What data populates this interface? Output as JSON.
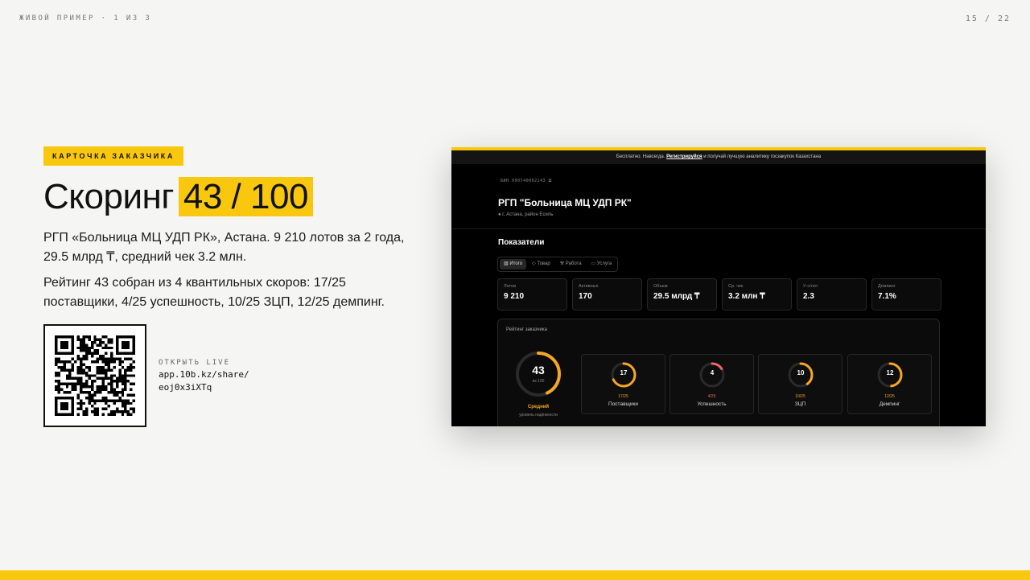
{
  "slide": {
    "top_left": "ЖИВОЙ ПРИМЕР · 1 ИЗ 3",
    "counter": "15 / 22",
    "eyebrow": "КАРТОЧКА ЗАКАЗЧИКА",
    "title_main": "Скоринг",
    "title_score": "43 / 100",
    "para1": "РГП «Больница МЦ УДП РК», Астана. 9 210 лотов за 2 года, 29.5 млрд ₸, средний чек 3.2 млн.",
    "para2": "Рейтинг 43 собран из 4 квантильных скоров: 17/25 поставщики, 4/25 успешность, 10/25 ЗЦП, 12/25 демпинг.",
    "live_label": "ОТКРЫТЬ LIVE",
    "live_url_1": "app.10b.kz/share/",
    "live_url_2": "eoj0x3iXTq"
  },
  "app": {
    "banner_pre": "Бесплатно. Навсегда.",
    "banner_link": "Регистрируйся",
    "banner_post": "и получай лучшую аналитику госзакупок Казахстана",
    "bin": "БИН 990740002243",
    "org_name": "РГП \"Больница МЦ УДП РК\"",
    "location": "г. Астана, район Есиль",
    "indicators_title": "Показатели",
    "tabs": [
      {
        "icon": "chart",
        "label": "Итого"
      },
      {
        "icon": "box",
        "label": "Товар"
      },
      {
        "icon": "wrench",
        "label": "Работа"
      },
      {
        "icon": "case",
        "label": "Услуга"
      }
    ],
    "kpis": [
      {
        "label": "Лотов",
        "value": "9 210"
      },
      {
        "label": "Активных",
        "value": "170"
      },
      {
        "label": "Объем",
        "value": "29.5 млрд ₸"
      },
      {
        "label": "Ср. чек",
        "value": "3.2 млн ₸"
      },
      {
        "label": "У-с/лот",
        "value": "2.3"
      },
      {
        "label": "Демпинг",
        "value": "7.1%"
      }
    ],
    "rating": {
      "title": "Рейтинг заказчика",
      "score": "43",
      "score_value": 43,
      "score_max": 100,
      "of_label": "из 100",
      "level": "Средний",
      "level_sub": "уровень надёжности",
      "accent": "#f5a623",
      "subscores": [
        {
          "value": 17,
          "max": 25,
          "num": "17",
          "sub": "17/25",
          "label": "Поставщики",
          "color": "#f5a623"
        },
        {
          "value": 4,
          "max": 25,
          "num": "4",
          "sub": "4/25",
          "label": "Успешность",
          "color": "#f0656b"
        },
        {
          "value": 10,
          "max": 25,
          "num": "10",
          "sub": "10/25",
          "label": "ЗЦП",
          "color": "#f5a623"
        },
        {
          "value": 12,
          "max": 25,
          "num": "12",
          "sub": "12/25",
          "label": "Демпинг",
          "color": "#f5a623"
        }
      ]
    }
  }
}
